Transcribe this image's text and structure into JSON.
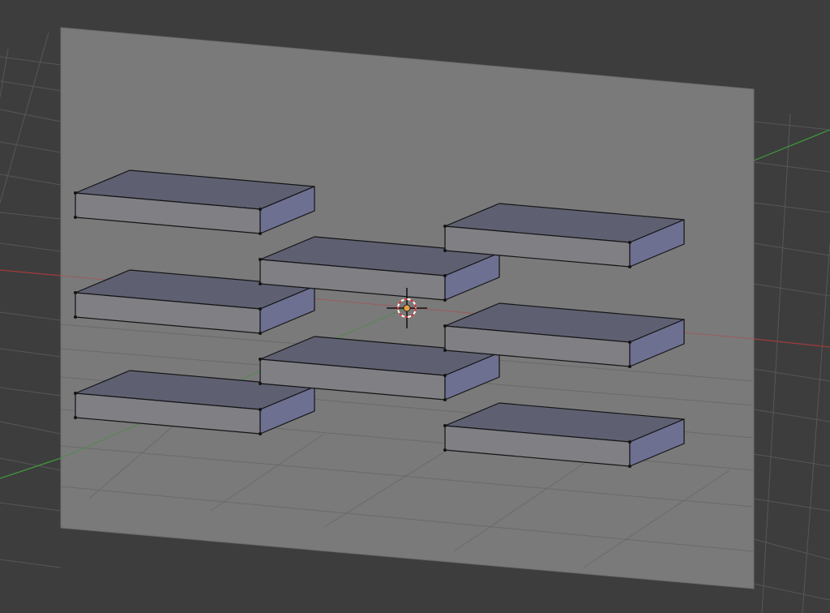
{
  "viewport": {
    "background": "#3d3d3d",
    "grid_color": "#5a5a5a",
    "x_axis_color": "#b03a3a",
    "y_axis_color": "#3f9a3f",
    "plane_color": "#7a7a7a",
    "box_top_color": "#5e6072",
    "box_front_color": "#7f7f84",
    "box_side_color": "#6d7091",
    "edge_color": "#141414",
    "cursor_icon": "3d-cursor-icon",
    "objects": {
      "plane": "plane",
      "boxes": [
        "box",
        "box",
        "box",
        "box",
        "box",
        "box",
        "box",
        "box"
      ]
    }
  }
}
